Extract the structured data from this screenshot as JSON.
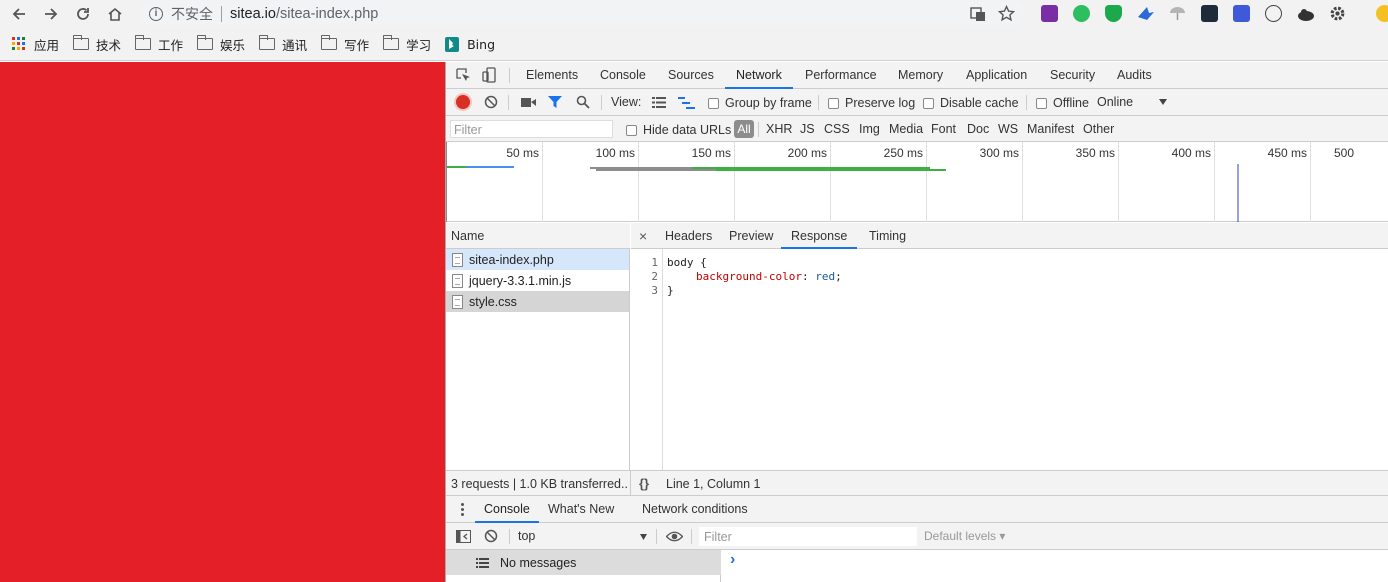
{
  "browser": {
    "security_label": "不安全",
    "url_host": "sitea.io",
    "url_path": "/sitea-index.php",
    "bookmarks": [
      {
        "label": "应用",
        "icon": "apps-grid-icon"
      },
      {
        "label": "技术",
        "icon": "folder-icon"
      },
      {
        "label": "工作",
        "icon": "folder-icon"
      },
      {
        "label": "娱乐",
        "icon": "folder-icon"
      },
      {
        "label": "通讯",
        "icon": "folder-icon"
      },
      {
        "label": "写作",
        "icon": "folder-icon"
      },
      {
        "label": "学习",
        "icon": "folder-icon"
      },
      {
        "label": "Bing",
        "icon": "bing-icon"
      }
    ]
  },
  "page": {
    "background": "#e51f27"
  },
  "devtools": {
    "tabs": [
      "Elements",
      "Console",
      "Sources",
      "Network",
      "Performance",
      "Memory",
      "Application",
      "Security",
      "Audits"
    ],
    "active_tab": "Network",
    "toolbar": {
      "view_label": "View:",
      "group_by_frame": "Group by frame",
      "preserve_log": "Preserve log",
      "disable_cache": "Disable cache",
      "offline": "Offline",
      "throttling": "Online"
    },
    "filter": {
      "placeholder": "Filter",
      "hide_data_urls": "Hide data URLs",
      "types": [
        "All",
        "XHR",
        "JS",
        "CSS",
        "Img",
        "Media",
        "Font",
        "Doc",
        "WS",
        "Manifest",
        "Other"
      ]
    },
    "overview_ticks": [
      "50 ms",
      "100 ms",
      "150 ms",
      "200 ms",
      "250 ms",
      "300 ms",
      "350 ms",
      "400 ms",
      "450 ms",
      "500"
    ],
    "requests": {
      "header": "Name",
      "items": [
        "sitea-index.php",
        "jquery-3.3.1.min.js",
        "style.css"
      ]
    },
    "detail_tabs": [
      "Headers",
      "Preview",
      "Response",
      "Timing"
    ],
    "active_detail_tab": "Response",
    "response_code": {
      "line_numbers": [
        "1",
        "2",
        "3"
      ],
      "line1": "body {",
      "line2_prop": "background-color",
      "line2_colon": ": ",
      "line2_value": "red",
      "line2_semicolon": ";",
      "line3": "}"
    },
    "status": {
      "summary": "3 requests | 1.0 KB transferred...",
      "braces": "{}",
      "cursor": "Line 1, Column 1"
    },
    "drawer": {
      "tabs": [
        "Console",
        "What's New",
        "Network conditions"
      ],
      "context": "top",
      "filter_placeholder": "Filter",
      "levels": "Default levels ▾",
      "no_messages": "No messages",
      "prompt": "›"
    }
  }
}
